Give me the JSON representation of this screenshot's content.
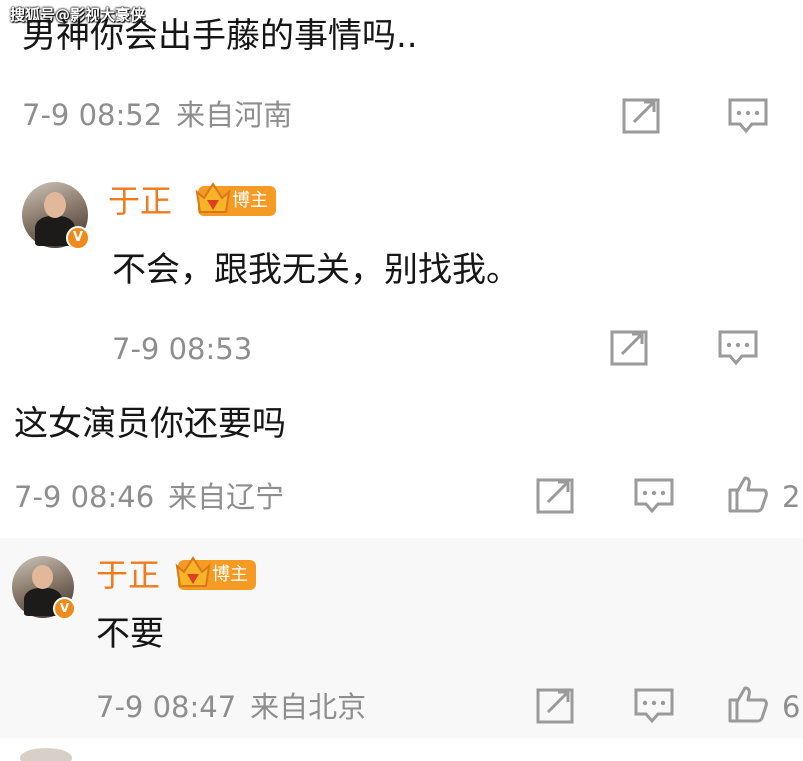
{
  "watermark": "搜狐号@影视大豪侠",
  "comments": [
    {
      "text": "男神你会出手藤的事情吗..",
      "time": "7-9 08:52",
      "location": "来自河南"
    },
    {
      "reply": true,
      "author": "于正",
      "badge": "博主",
      "text": "不会，跟我无关，别找我。",
      "time": "7-9 08:53"
    },
    {
      "text": "这女演员你还要吗",
      "time": "7-9 08:46",
      "location": "来自辽宁",
      "likes": "2"
    },
    {
      "reply": true,
      "author": "于正",
      "badge": "博主",
      "text": "不要",
      "time": "7-9 08:47",
      "location": "来自北京",
      "likes": "6"
    }
  ],
  "verified_mark": "V",
  "colors": {
    "author": "#f07a1c",
    "badge": "#f59a23",
    "meta": "#8e8e8e",
    "text": "#161616",
    "icon": "#9a9a9a"
  },
  "icons": [
    "share-icon",
    "comment-icon",
    "like-icon"
  ]
}
